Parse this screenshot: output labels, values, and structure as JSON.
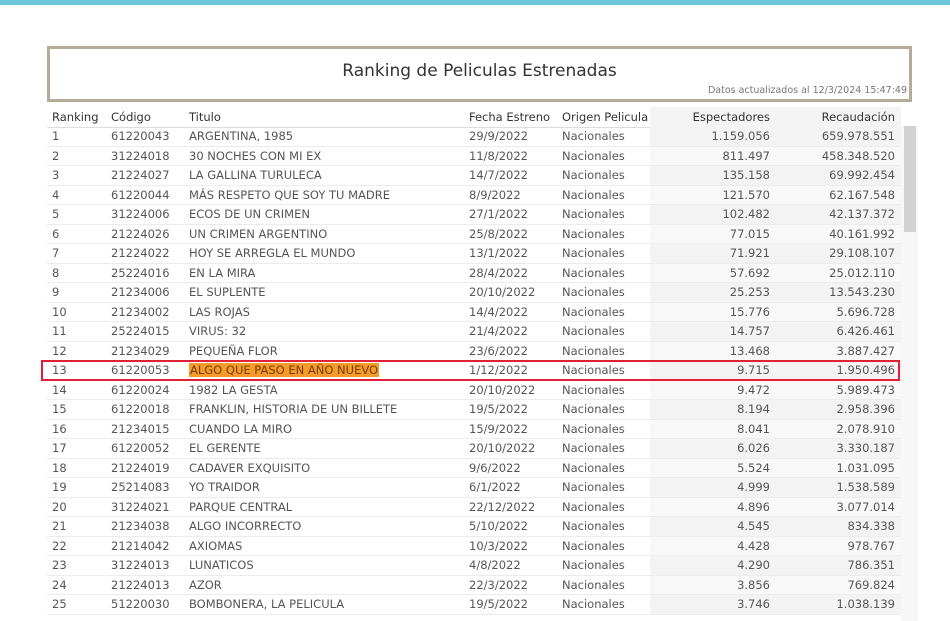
{
  "report": {
    "title": "Ranking de Peliculas Estrenadas",
    "updated": "Datos actualizados al 12/3/2024 15:47:49"
  },
  "columns": {
    "ranking": "Ranking",
    "codigo": "Código",
    "titulo": "Titulo",
    "fecha": "Fecha Estreno",
    "origen": "Origen Pelicula",
    "espectadores": "Espectadores",
    "recaudacion": "Recaudación"
  },
  "rows": [
    [
      "1",
      "61220043",
      "ARGENTINA, 1985",
      "29/9/2022",
      "Nacionales",
      "1.159.056",
      "659.978.551"
    ],
    [
      "2",
      "31224018",
      "30 NOCHES CON MI EX",
      "11/8/2022",
      "Nacionales",
      "811.497",
      "458.348.520"
    ],
    [
      "3",
      "21224027",
      "LA GALLINA TURULECA",
      "14/7/2022",
      "Nacionales",
      "135.158",
      "69.992.454"
    ],
    [
      "4",
      "61220044",
      "MÁS RESPETO QUE SOY TU MADRE",
      "8/9/2022",
      "Nacionales",
      "121.570",
      "62.167.548"
    ],
    [
      "5",
      "31224006",
      "ECOS DE UN CRIMEN",
      "27/1/2022",
      "Nacionales",
      "102.482",
      "42.137.372"
    ],
    [
      "6",
      "21224026",
      "UN CRIMEN ARGENTINO",
      "25/8/2022",
      "Nacionales",
      "77.015",
      "40.161.992"
    ],
    [
      "7",
      "21224022",
      "HOY SE ARREGLA EL MUNDO",
      "13/1/2022",
      "Nacionales",
      "71.921",
      "29.108.107"
    ],
    [
      "8",
      "25224016",
      "EN LA MIRA",
      "28/4/2022",
      "Nacionales",
      "57.692",
      "25.012.110"
    ],
    [
      "9",
      "21234006",
      "EL SUPLENTE",
      "20/10/2022",
      "Nacionales",
      "25.253",
      "13.543.230"
    ],
    [
      "10",
      "21234002",
      "LAS ROJAS",
      "14/4/2022",
      "Nacionales",
      "15.776",
      "5.696.728"
    ],
    [
      "11",
      "25224015",
      "VIRUS: 32",
      "21/4/2022",
      "Nacionales",
      "14.757",
      "6.426.461"
    ],
    [
      "12",
      "21234029",
      "PEQUEÑA FLOR",
      "23/6/2022",
      "Nacionales",
      "13.468",
      "3.887.427"
    ],
    [
      "13",
      "61220053",
      "ALGO QUE PASO EN AÑO NUEVO",
      "1/12/2022",
      "Nacionales",
      "9.715",
      "1.950.496"
    ],
    [
      "14",
      "61220024",
      "1982 LA GESTA",
      "20/10/2022",
      "Nacionales",
      "9.472",
      "5.989.473"
    ],
    [
      "15",
      "61220018",
      "FRANKLIN, HISTORIA DE UN BILLETE",
      "19/5/2022",
      "Nacionales",
      "8.194",
      "2.958.396"
    ],
    [
      "16",
      "21234015",
      "CUANDO LA MIRO",
      "15/9/2022",
      "Nacionales",
      "8.041",
      "2.078.910"
    ],
    [
      "17",
      "61220052",
      "EL GERENTE",
      "20/10/2022",
      "Nacionales",
      "6.026",
      "3.330.187"
    ],
    [
      "18",
      "21224019",
      "CADAVER EXQUISITO",
      "9/6/2022",
      "Nacionales",
      "5.524",
      "1.031.095"
    ],
    [
      "19",
      "25214083",
      "YO TRAIDOR",
      "6/1/2022",
      "Nacionales",
      "4.999",
      "1.538.589"
    ],
    [
      "20",
      "31224021",
      "PARQUE CENTRAL",
      "22/12/2022",
      "Nacionales",
      "4.896",
      "3.077.014"
    ],
    [
      "21",
      "21234038",
      "ALGO INCORRECTO",
      "5/10/2022",
      "Nacionales",
      "4.545",
      "834.338"
    ],
    [
      "22",
      "21214042",
      "AXIOMAS",
      "10/3/2022",
      "Nacionales",
      "4.428",
      "978.767"
    ],
    [
      "23",
      "31224013",
      "LUNATICOS",
      "4/8/2022",
      "Nacionales",
      "4.290",
      "786.351"
    ],
    [
      "24",
      "21224013",
      "AZOR",
      "22/3/2022",
      "Nacionales",
      "3.856",
      "769.824"
    ],
    [
      "25",
      "51220030",
      "BOMBONERA, LA PELICULA",
      "19/5/2022",
      "Nacionales",
      "3.746",
      "1.038.139"
    ]
  ],
  "highlight_row_index": 12,
  "colors": {
    "accent_rule": "#6cc6dc",
    "title_border": "#b5ab98",
    "highlight_box": "#e02036",
    "highlight_fill": "#f39c2a"
  }
}
